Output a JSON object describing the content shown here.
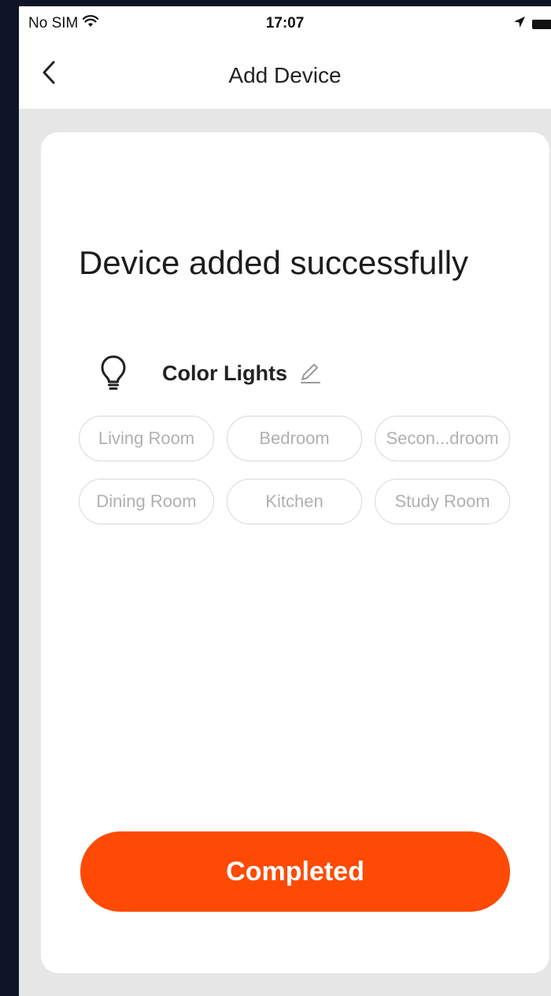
{
  "status_bar": {
    "carrier": "No SIM",
    "time": "17:07",
    "wifi_icon": "wifi-icon",
    "location_icon": "location-arrow-icon",
    "battery_icon": "battery-icon"
  },
  "nav": {
    "title": "Add Device",
    "back_icon": "chevron-left-icon"
  },
  "card": {
    "title": "Device added successfully",
    "device": {
      "icon": "lightbulb-icon",
      "name": "Color Lights",
      "edit_icon": "pencil-icon"
    },
    "rooms": [
      {
        "label": "Living Room"
      },
      {
        "label": "Bedroom"
      },
      {
        "label": "Secon...droom"
      },
      {
        "label": "Dining Room"
      },
      {
        "label": "Kitchen"
      },
      {
        "label": "Study Room"
      }
    ],
    "completed_label": "Completed"
  },
  "colors": {
    "accent": "#fe4a04",
    "background": "#e6e6e6",
    "card": "#ffffff",
    "chip_border": "#d8d8d8",
    "chip_text": "#b0b0b0"
  }
}
